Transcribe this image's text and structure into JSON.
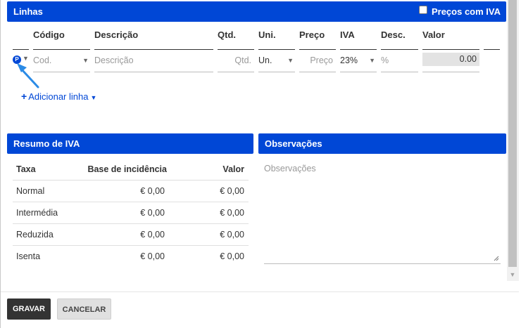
{
  "lines": {
    "title": "Linhas",
    "prices_with_vat_label": "Preços com IVA",
    "columns": {
      "code": "Código",
      "description": "Descrição",
      "qty": "Qtd.",
      "unit": "Uni.",
      "price": "Preço",
      "vat": "IVA",
      "discount": "Desc.",
      "value": "Valor"
    },
    "row": {
      "product_badge": "P",
      "code_placeholder": "Cod.",
      "description_placeholder": "Descrição",
      "qty_placeholder": "Qtd.",
      "unit_value": "Un.",
      "price_placeholder": "Preço",
      "vat_value": "23%",
      "discount_placeholder": "%",
      "value": "0.00"
    },
    "add_line_label": "Adicionar linha"
  },
  "vat_summary": {
    "title": "Resumo de IVA",
    "headers": [
      "Taxa",
      "Base de incidência",
      "Valor"
    ],
    "rows": [
      {
        "rate": "Normal",
        "base": "€ 0,00",
        "value": "€ 0,00"
      },
      {
        "rate": "Intermédia",
        "base": "€ 0,00",
        "value": "€ 0,00"
      },
      {
        "rate": "Reduzida",
        "base": "€ 0,00",
        "value": "€ 0,00"
      },
      {
        "rate": "Isenta",
        "base": "€ 0,00",
        "value": "€ 0,00"
      }
    ]
  },
  "observations": {
    "title": "Observações",
    "placeholder": "Observações"
  },
  "footer": {
    "save_label": "GRAVAR",
    "cancel_label": "CANCELAR"
  },
  "colors": {
    "accent": "#0047d6",
    "save_button": "#333333"
  }
}
